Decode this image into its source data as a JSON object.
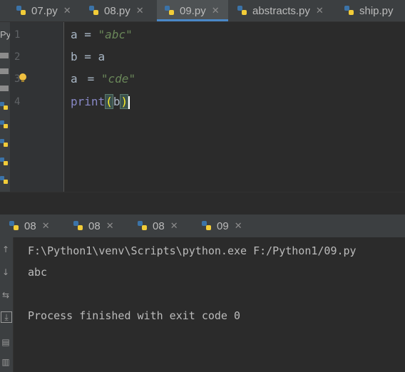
{
  "editor_tabs": [
    {
      "label": "07.py",
      "active": false
    },
    {
      "label": "08.py",
      "active": false
    },
    {
      "label": "09.py",
      "active": true
    },
    {
      "label": "abstracts.py",
      "active": false
    },
    {
      "label": "ship.py",
      "active": false
    }
  ],
  "tool_strip_label": "Py",
  "line_numbers": [
    "1",
    "2",
    "3",
    "4"
  ],
  "code": {
    "line1": {
      "var": "a",
      "op": " = ",
      "str": "\"abc\""
    },
    "line2": {
      "text": "b = a"
    },
    "line3": {
      "var": "a",
      "op": "= ",
      "str": "\"cde\""
    },
    "line4": {
      "fn": "print",
      "open": "(",
      "arg": "b",
      "close": ")"
    }
  },
  "run_tabs": [
    "08",
    "08",
    "08",
    "09"
  ],
  "console": {
    "command": "F:\\Python1\\venv\\Scripts\\python.exe F:/Python1/09.py",
    "output": "abc",
    "exit_message": "Process finished with exit code 0"
  },
  "icons": [
    "python-file-icon",
    "lightbulb-icon",
    "close-icon",
    "rerun-icon",
    "scroll-down-icon",
    "print-icon",
    "soft-wrap-icon"
  ],
  "colors": {
    "accent": "#4a88c7",
    "string": "#6a8759",
    "builtin": "#8888c6"
  }
}
